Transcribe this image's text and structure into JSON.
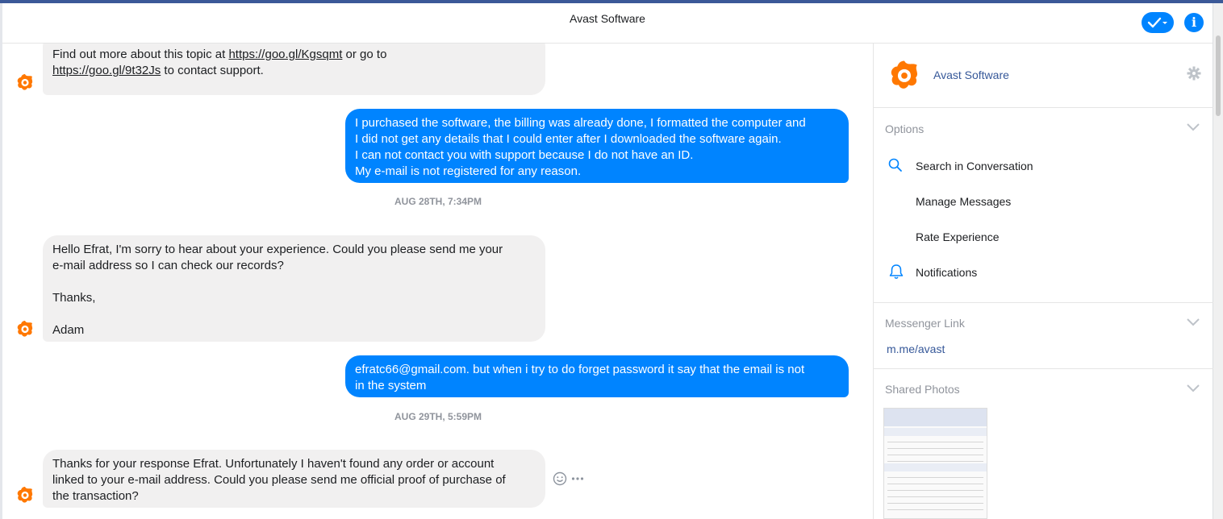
{
  "window": {
    "title": "Avast Software"
  },
  "header": {
    "title": "Avast Software",
    "check_icon": "check-dropdown-icon",
    "info_icon": "info-icon",
    "accent": "#0084ff"
  },
  "messages": [
    {
      "from": "avast",
      "text": "Find out more about this topic at ",
      "link1": "https://goo.gl/Kgsqmt",
      "mid": " or go to",
      "link2": "https://goo.gl/9t32Js",
      "tail": " to contact support."
    },
    {
      "from": "user",
      "text": "I purchased the software, the billing was already done, I formatted the computer and\nI did not get any details that I could enter after I downloaded the software again.\nI can not contact you with support because I do not have an ID.\nMy e-mail is not registered for any reason."
    },
    {
      "timestamp": "AUG 28TH, 7:34PM"
    },
    {
      "from": "avast",
      "text": "Hello Efrat, I'm sorry to hear about your experience. Could you please send me your\ne-mail address so I can check our records?\n\nThanks,\n\nAdam"
    },
    {
      "from": "user",
      "text": "efratc66@gmail.com. but when i try to do forget password it say that the email is not\nin the system"
    },
    {
      "timestamp": "AUG 29TH, 5:59PM"
    },
    {
      "from": "avast",
      "text": "Thanks for your response Efrat. Unfortunately I haven't found any order or account\nlinked to your e-mail address. Could you please send me official proof of purchase of\nthe transaction?"
    }
  ],
  "sidebar": {
    "name": "Avast Software",
    "brand_color": "#ff7800",
    "options_title": "Options",
    "options": [
      {
        "label": "Search in Conversation",
        "icon": "search-icon"
      },
      {
        "label": "Manage Messages",
        "icon": ""
      },
      {
        "label": "Rate Experience",
        "icon": ""
      },
      {
        "label": "Notifications",
        "icon": "bell-icon"
      }
    ],
    "messenger_link_title": "Messenger Link",
    "messenger_link": "m.me/avast",
    "shared_photos_title": "Shared Photos"
  }
}
